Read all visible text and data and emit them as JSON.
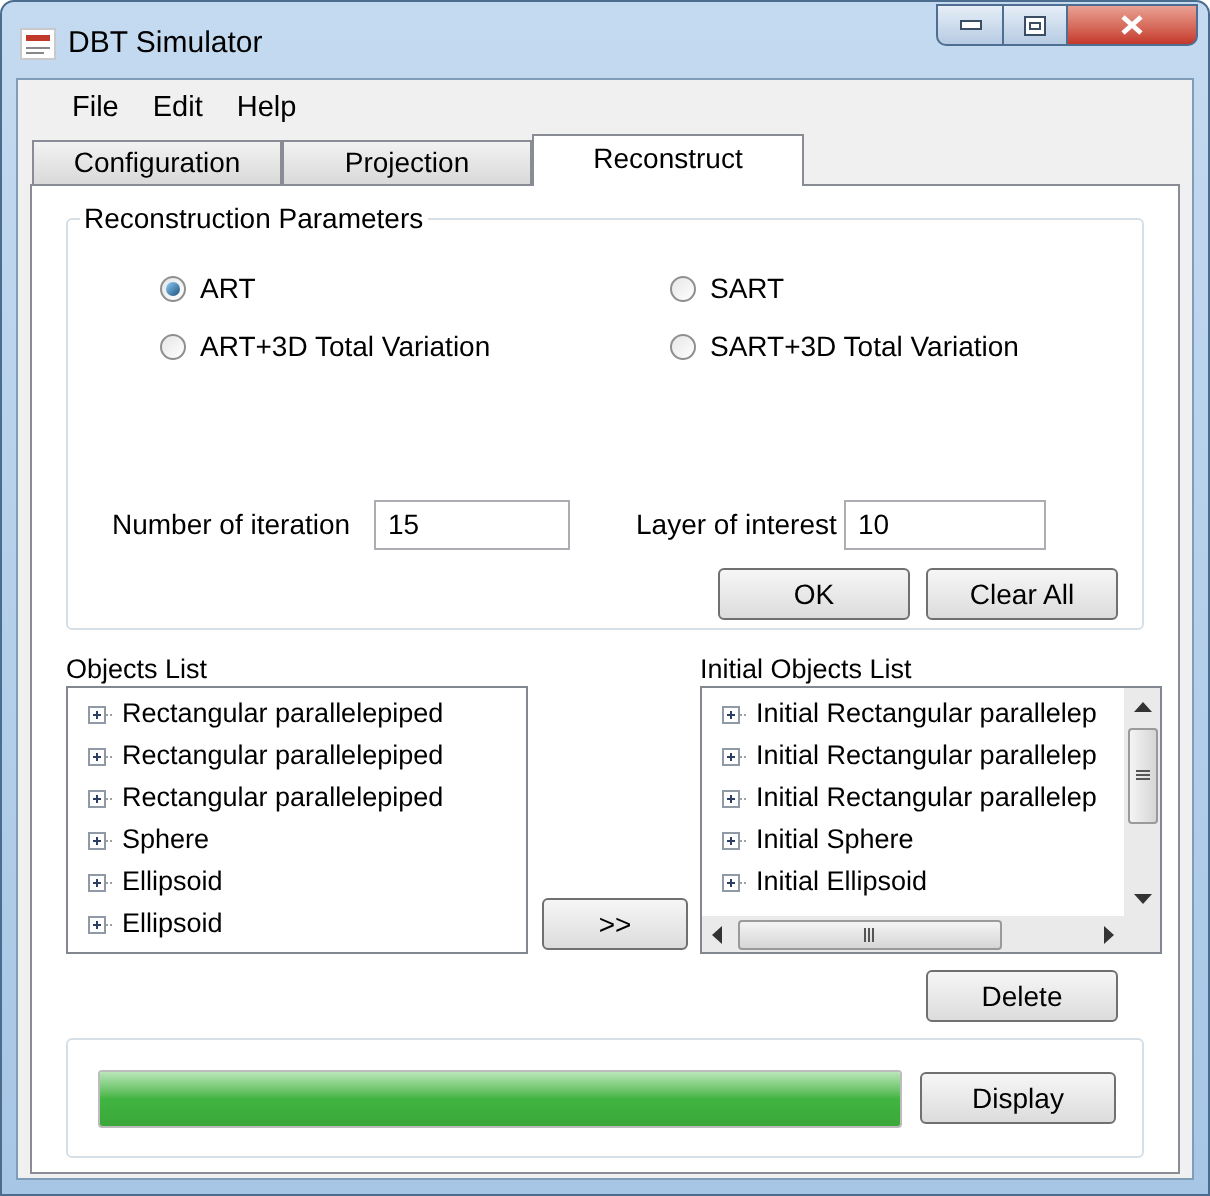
{
  "window": {
    "title": "DBT Simulator"
  },
  "menu": [
    "File",
    "Edit",
    "Help"
  ],
  "tabs": [
    {
      "label": "Configuration",
      "selected": false
    },
    {
      "label": "Projection",
      "selected": false
    },
    {
      "label": "Reconstruct",
      "selected": true
    }
  ],
  "reconstruction_parameters": {
    "title": "Reconstruction Parameters",
    "methods": [
      {
        "label": "ART",
        "selected": true
      },
      {
        "label": "SART",
        "selected": false
      },
      {
        "label": "ART+3D Total Variation",
        "selected": false
      },
      {
        "label": "SART+3D Total Variation",
        "selected": false
      }
    ],
    "number_of_iteration": {
      "label": "Number of iteration",
      "value": "15"
    },
    "layer_of_interest": {
      "label": "Layer of interest",
      "value": "10"
    },
    "buttons": [
      "OK",
      "Clear All"
    ]
  },
  "objects_list": {
    "label": "Objects List",
    "items": [
      {
        "label": "Rectangular parallelepiped",
        "expanded": false
      },
      {
        "label": "Rectangular parallelepiped",
        "expanded": false
      },
      {
        "label": "Rectangular parallelepiped",
        "expanded": false
      },
      {
        "label": "Sphere",
        "expanded": false
      },
      {
        "label": "Ellipsoid",
        "expanded": false
      },
      {
        "label": "Ellipsoid",
        "expanded": false
      }
    ]
  },
  "move_button": ">>",
  "initial_objects_list": {
    "label": "Initial Objects List",
    "items": [
      {
        "label": "Initial Rectangular parallelep",
        "expanded": false
      },
      {
        "label": "Initial Rectangular parallelep",
        "expanded": false
      },
      {
        "label": "Initial Rectangular parallelep",
        "expanded": false
      },
      {
        "label": "Initial Sphere",
        "expanded": false
      },
      {
        "label": "Initial Ellipsoid",
        "expanded": false
      }
    ]
  },
  "delete_button": "Delete",
  "progress": {
    "level": 1
  },
  "display_button": "Display"
}
